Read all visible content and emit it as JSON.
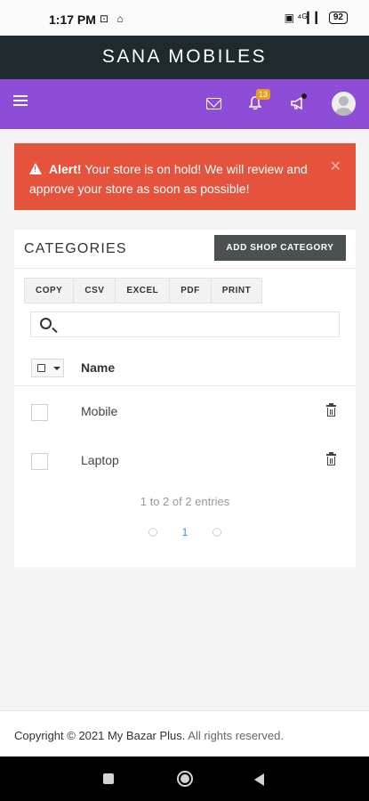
{
  "status_bar": {
    "time": "1:17 PM",
    "left_icons": "⊡ ⌂",
    "signal": "▣ ⁴ᴳ▎▎",
    "battery": "92"
  },
  "brand": {
    "title": "SANA MOBILES"
  },
  "navbar": {
    "icons": [
      "menu-icon",
      "mail-icon",
      "bell-icon",
      "announcement-icon",
      "avatar"
    ],
    "notification_count": "13"
  },
  "alert": {
    "strong": "Alert!",
    "message": " Your store is on hold! We will review and approve your store as soon as possible!",
    "close": "✕"
  },
  "categories": {
    "title": "CATEGORIES",
    "add_button": "ADD SHOP CATEGORY",
    "export_buttons": [
      "COPY",
      "CSV",
      "EXCEL",
      "PDF",
      "PRINT"
    ],
    "search_placeholder": "",
    "column_name": "Name",
    "rows": [
      {
        "name": "Mobile"
      },
      {
        "name": "Laptop"
      }
    ],
    "entries_info": "1 to 2 of 2 entries",
    "current_page": "1"
  },
  "footer": {
    "copyright": "Copyright © 2021 My Bazar Plus.",
    "rights": "All rights reserved."
  },
  "colors": {
    "brand_bar": "#1f2a2c",
    "nav_bar": "#8e4dd6",
    "alert": "#e6533c",
    "badge": "#e59f1c",
    "button_dark": "#4b5052",
    "link": "#2c8fd6"
  }
}
